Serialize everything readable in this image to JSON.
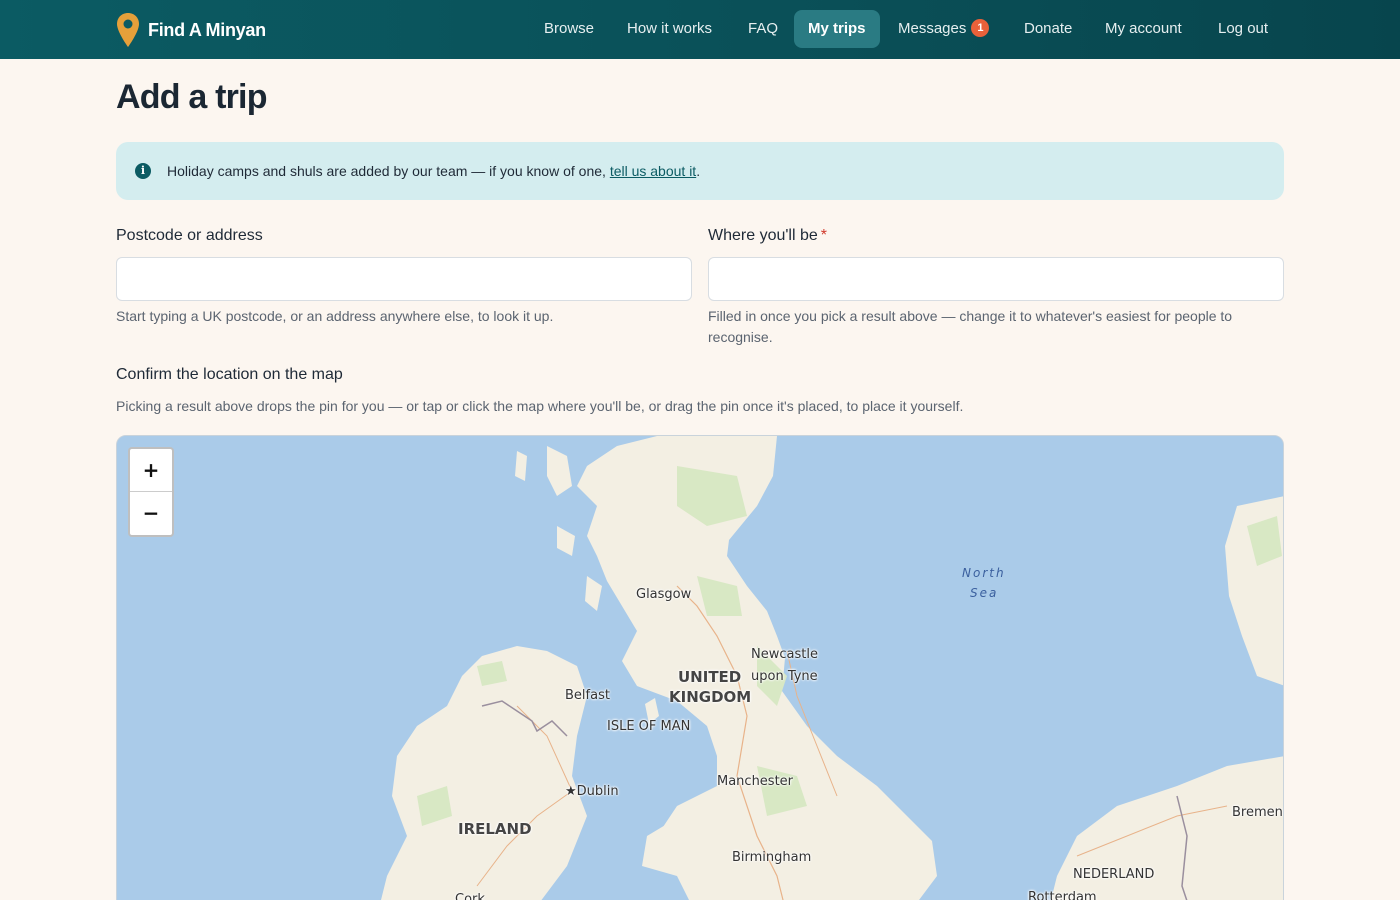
{
  "header": {
    "brand_name": "Find A Minyan",
    "brand_color": "#e6a03a",
    "nav": [
      {
        "label": "Browse"
      },
      {
        "label": "How it works"
      },
      {
        "label": "FAQ"
      },
      {
        "label": "My trips",
        "active": true
      },
      {
        "label": "Messages",
        "badge": "1"
      },
      {
        "label": "Donate"
      },
      {
        "label": "My account"
      },
      {
        "label": "Log out"
      }
    ]
  },
  "page": {
    "title": "Add a trip",
    "notice": {
      "icon": "info-icon",
      "text_before": "Holiday camps and shuls are added by our team — if you know of one, ",
      "link_text": "tell us about it",
      "text_after": "."
    },
    "postcode_field": {
      "label": "Postcode or address",
      "value": "",
      "placeholder": "",
      "help": "Start typing a UK postcode, or an address anywhere else, to look it up."
    },
    "location_field": {
      "label": "Where you'll be",
      "required_marker": "*",
      "value": "",
      "placeholder": "",
      "help": "Filled in once you pick a result above — change it to whatever's easiest for people to recognise."
    },
    "map_section": {
      "label": "Confirm the location on the map",
      "help": "Picking a result above drops the pin for you — or tap or click the map where you'll be, or drag the pin once it's placed, to place it yourself."
    }
  },
  "map": {
    "zoom_in": "+",
    "zoom_out": "−",
    "labels": {
      "glasgow": "Glasgow",
      "newcastle_1": "Newcastle",
      "newcastle_2": "upon Tyne",
      "uk_1": "UNITED",
      "uk_2": "KINGDOM",
      "belfast": "Belfast",
      "isle_of_man": "ISLE OF MAN",
      "dublin": "★Dublin",
      "manchester": "Manchester",
      "ireland": "IRELAND",
      "birmingham": "Birmingham",
      "north_sea_1": "North",
      "north_sea_2": "Sea",
      "bremen": "Bremen",
      "nederland": "NEDERLAND",
      "cork": "Cork",
      "rotterdam": "Rotterdam"
    },
    "colors": {
      "water": "#aacbe9",
      "land": "#f3efe3",
      "green": "#d8e8c4"
    }
  }
}
